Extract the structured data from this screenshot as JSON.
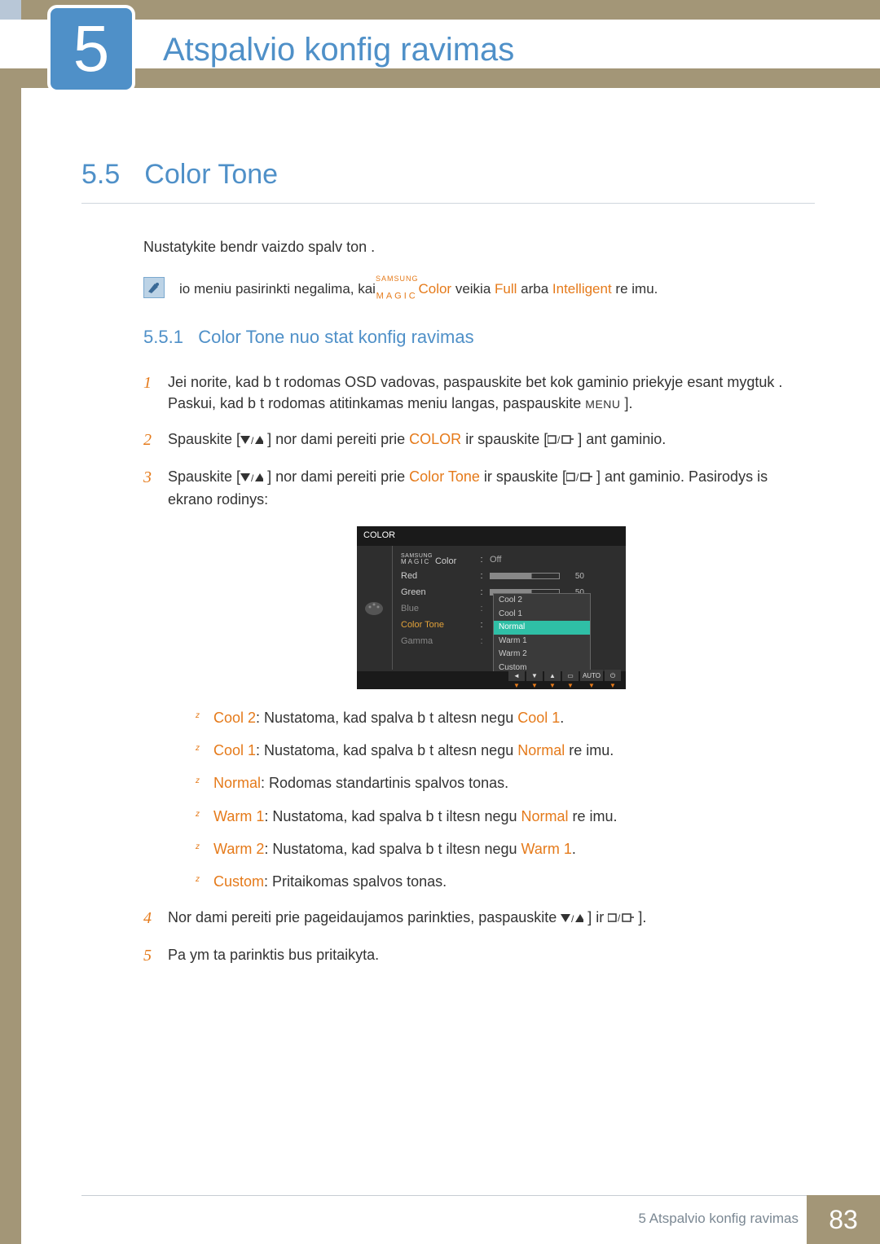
{
  "header": {
    "chapter_number": "5",
    "chapter_title": "Atspalvio konfig ravimas"
  },
  "section": {
    "number": "5.5",
    "title": "Color Tone",
    "intro": "Nustatykite bendr  vaizdo spalv  ton .",
    "note_prefix": "io meniu pasirinkti negalima, kai",
    "note_samsung_top": "SAMSUNG",
    "note_samsung_bot": "MAGIC",
    "note_color": "Color",
    "note_mid": " veikia",
    "note_full": "Full",
    "note_or": " arba ",
    "note_intelligent": "Intelligent",
    "note_suffix": " re imu."
  },
  "subsection": {
    "number": "5.5.1",
    "title": "Color Tone nuo stat  konfig ravimas"
  },
  "steps": {
    "s1a": "Jei norite, kad b t  rodomas OSD vadovas, paspauskite bet kok  gaminio priekyje esant  mygtuk . Paskui, kad b t  rodomas atitinkamas meniu langas, paspauskite ",
    "s1_menu": "MENU",
    "s1b": " ].",
    "s2a": "Spauskite [",
    "s2b": "] nor dami pereiti prie",
    "s2_color": "COLOR",
    "s2c": " ir spauskite [",
    "s2d": "] ant gaminio.",
    "s3a": "Spauskite [",
    "s3b": "] nor dami pereiti prie",
    "s3_ct": "Color Tone",
    "s3c": " ir spauskite [",
    "s3d": "] ant gaminio. Pasirodys  is ekrano rodinys:",
    "s4a": "Nor dami pereiti prie pageidaujamos parinkties, paspauskite",
    "s4b": "] ir",
    "s4c": "].",
    "s5": "Pa ym ta parinktis bus pritaikyta."
  },
  "osd": {
    "title": "COLOR",
    "rows": {
      "magic_top": "SAMSUNG",
      "magic_bot": "MAGIC",
      "magic_lbl": " Color",
      "off": "Off",
      "red": "Red",
      "red_val": "50",
      "green": "Green",
      "green_val": "50",
      "blue": "Blue",
      "color_tone": "Color Tone",
      "gamma": "Gamma"
    },
    "dropdown": [
      "Cool 2",
      "Cool 1",
      "Normal",
      "Warm 1",
      "Warm 2",
      "Custom"
    ],
    "footer_auto": "AUTO"
  },
  "bullets": {
    "cool2_k": "Cool 2",
    "cool2_t": ": Nustatoma, kad spalva b t   altesn  negu  ",
    "cool2_r": "Cool 1",
    "cool2_e": ".",
    "cool1_k": "Cool 1",
    "cool1_t": ": Nustatoma, kad spalva b t   altesn  negu  ",
    "cool1_r": "Normal",
    "cool1_e": " re imu.",
    "normal_k": "Normal",
    "normal_t": ": Rodomas standartinis spalvos tonas.",
    "warm1_k": "Warm 1",
    "warm1_t": ": Nustatoma, kad spalva b t   iltesn  negu  ",
    "warm1_r": "Normal",
    "warm1_e": " re imu.",
    "warm2_k": "Warm 2",
    "warm2_t": ": Nustatoma, kad spalva b t   iltesn  negu  ",
    "warm2_r": "Warm 1",
    "warm2_e": ".",
    "custom_k": "Custom",
    "custom_t": ": Pritaikomas spalvos tonas."
  },
  "footer": {
    "text": "5 Atspalvio konfig ravimas",
    "page": "83"
  }
}
